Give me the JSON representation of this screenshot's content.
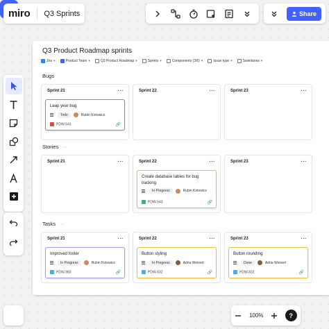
{
  "app": {
    "logo": "miro",
    "board_name": "Q3 Sprints"
  },
  "toolbar": {
    "share_label": "Share"
  },
  "zoom": {
    "level": "100%"
  },
  "board": {
    "title": "Q3 Product Roadmap sprints",
    "filters": [
      {
        "label": "Jira",
        "icon_color": "#2684ff"
      },
      {
        "label": "Product Team",
        "icon_color": "#4262ff"
      },
      {
        "label": "Q3 Product Roadmap",
        "icon_color": "#777777"
      },
      {
        "label": "Sprints",
        "icon_color": "#777777"
      },
      {
        "label": "Components (3/6)",
        "icon_color": "#777777"
      },
      {
        "label": "Issue type",
        "icon_color": "#777777"
      },
      {
        "label": "Swimlanes",
        "icon_color": "#777777"
      }
    ],
    "columns": [
      "Sprint 21",
      "Sprint 22",
      "Sprint 23"
    ],
    "sections": [
      {
        "label": "Bugs"
      },
      {
        "label": "Stories"
      },
      {
        "label": "Tasks"
      }
    ],
    "cards": {
      "bug": {
        "title": "Leap year bug",
        "status": "Todo",
        "assignee": "Rubin Kotowicz",
        "key": "PDW-543",
        "border": "#e36d6d",
        "issue_color": "#e5493a"
      },
      "story": {
        "title": "Create database tables for bug tracking",
        "status": "In Progress",
        "assignee": "Rubin Kotowicz",
        "key": "PDW-543",
        "border": "#e8c53a",
        "issue_color": "#36b37e"
      },
      "task1": {
        "title": "Improved footer",
        "status": "In Progress",
        "assignee": "Rubin Kotowicz",
        "key": "PDW-983",
        "border": "#a79ae0",
        "issue_color": "#4bade8"
      },
      "task2": {
        "title": "Button styling",
        "status": "In Progress",
        "assignee": "Adria Weinert",
        "key": "PDW-632",
        "border": "#e8c53a",
        "issue_color": "#4bade8"
      },
      "task3": {
        "title": "Button rounding",
        "status": "Done",
        "assignee": "Adria Weinert",
        "key": "PDW-832",
        "border": "#e8c53a",
        "issue_color": "#4bade8"
      }
    }
  },
  "colors": {
    "accent": "#4262ff"
  }
}
